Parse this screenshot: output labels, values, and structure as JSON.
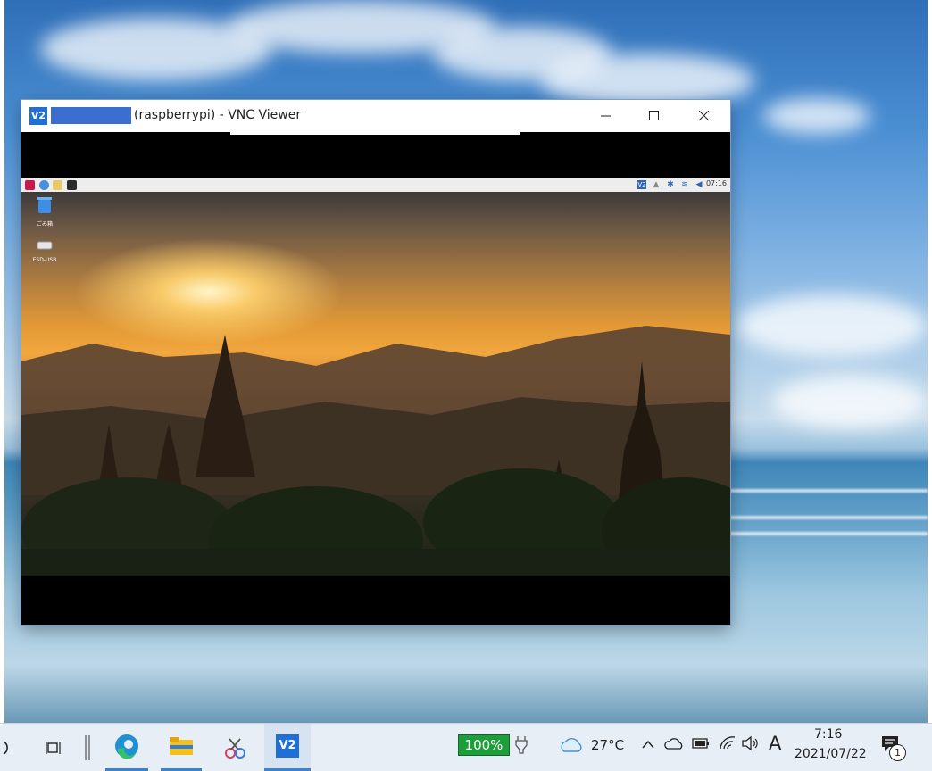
{
  "vnc_window": {
    "logo": "V2",
    "title": "(raspberrypi) - VNC Viewer",
    "buttons": {
      "minimize": "minimize",
      "maximize": "maximize",
      "close": "close"
    }
  },
  "remote_desktop": {
    "taskbar": {
      "clock": "07:16",
      "tray_logo": "V2"
    },
    "desktop_icons": [
      {
        "label": "ごみ箱",
        "icon": "trash-icon"
      },
      {
        "label": "ESD-USB",
        "icon": "drive-icon"
      }
    ]
  },
  "host_taskbar": {
    "battery_percent": "100%",
    "weather": "27°C",
    "input_indicator": "A",
    "time": "7:16",
    "date": "2021/07/22",
    "notification_count": "1",
    "vnc_app_label": "V2",
    "accent_color": "#3b82d6"
  }
}
